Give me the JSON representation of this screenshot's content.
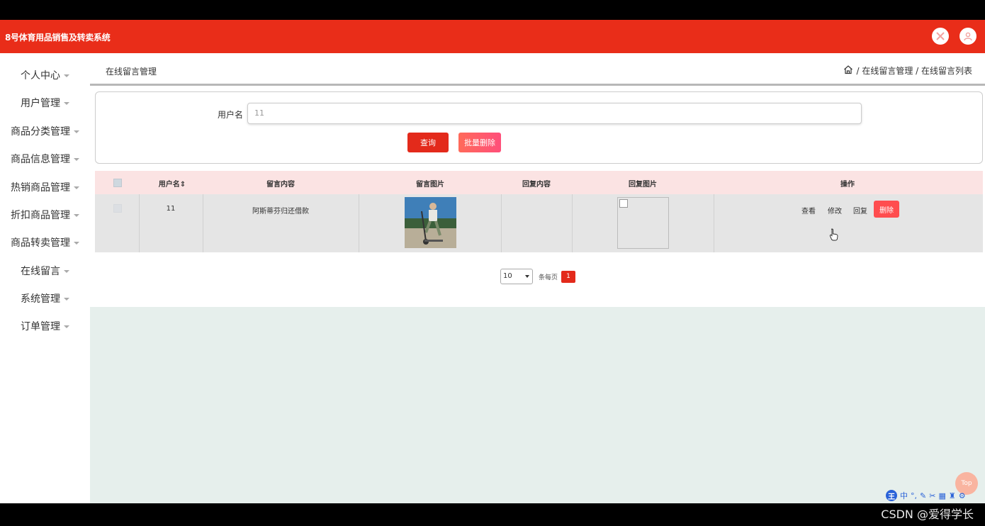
{
  "app": {
    "title": "8号体育用品销售及转卖系统"
  },
  "sidebar": {
    "items": [
      {
        "label": "个人中心"
      },
      {
        "label": "用户管理"
      },
      {
        "label": "商品分类管理"
      },
      {
        "label": "商品信息管理"
      },
      {
        "label": "热销商品管理"
      },
      {
        "label": "折扣商品管理"
      },
      {
        "label": "商品转卖管理"
      },
      {
        "label": "在线留言"
      },
      {
        "label": "系统管理"
      },
      {
        "label": "订单管理"
      }
    ]
  },
  "breadcrumb": {
    "page_title": "在线留言管理",
    "path": "/ 在线留言管理 / 在线留言列表"
  },
  "search": {
    "label": "用户名",
    "value": "11",
    "query_button": "查询",
    "batch_delete_button": "批量删除"
  },
  "table": {
    "headers": [
      "用户名",
      "留言内容",
      "留言图片",
      "回复内容",
      "回复图片",
      "操作"
    ],
    "rows": [
      {
        "username": "11",
        "content": "阿斯蒂芬归还借款",
        "reply": "",
        "actions": {
          "view": "查看",
          "edit": "修改",
          "reply": "回复",
          "delete": "删除"
        }
      }
    ]
  },
  "pagination": {
    "page_size": "10",
    "per_page_text": "条每页",
    "current_page": "1"
  },
  "top_button": "Top",
  "ime": {
    "logo": "王",
    "mode": "中"
  },
  "watermark": "CSDN @爱得学长",
  "colors": {
    "header": "#e92d19",
    "primary": "#e32a1b",
    "danger": "#ff4d4f",
    "table_header": "#fbe3e3",
    "background": "#e6efec"
  }
}
